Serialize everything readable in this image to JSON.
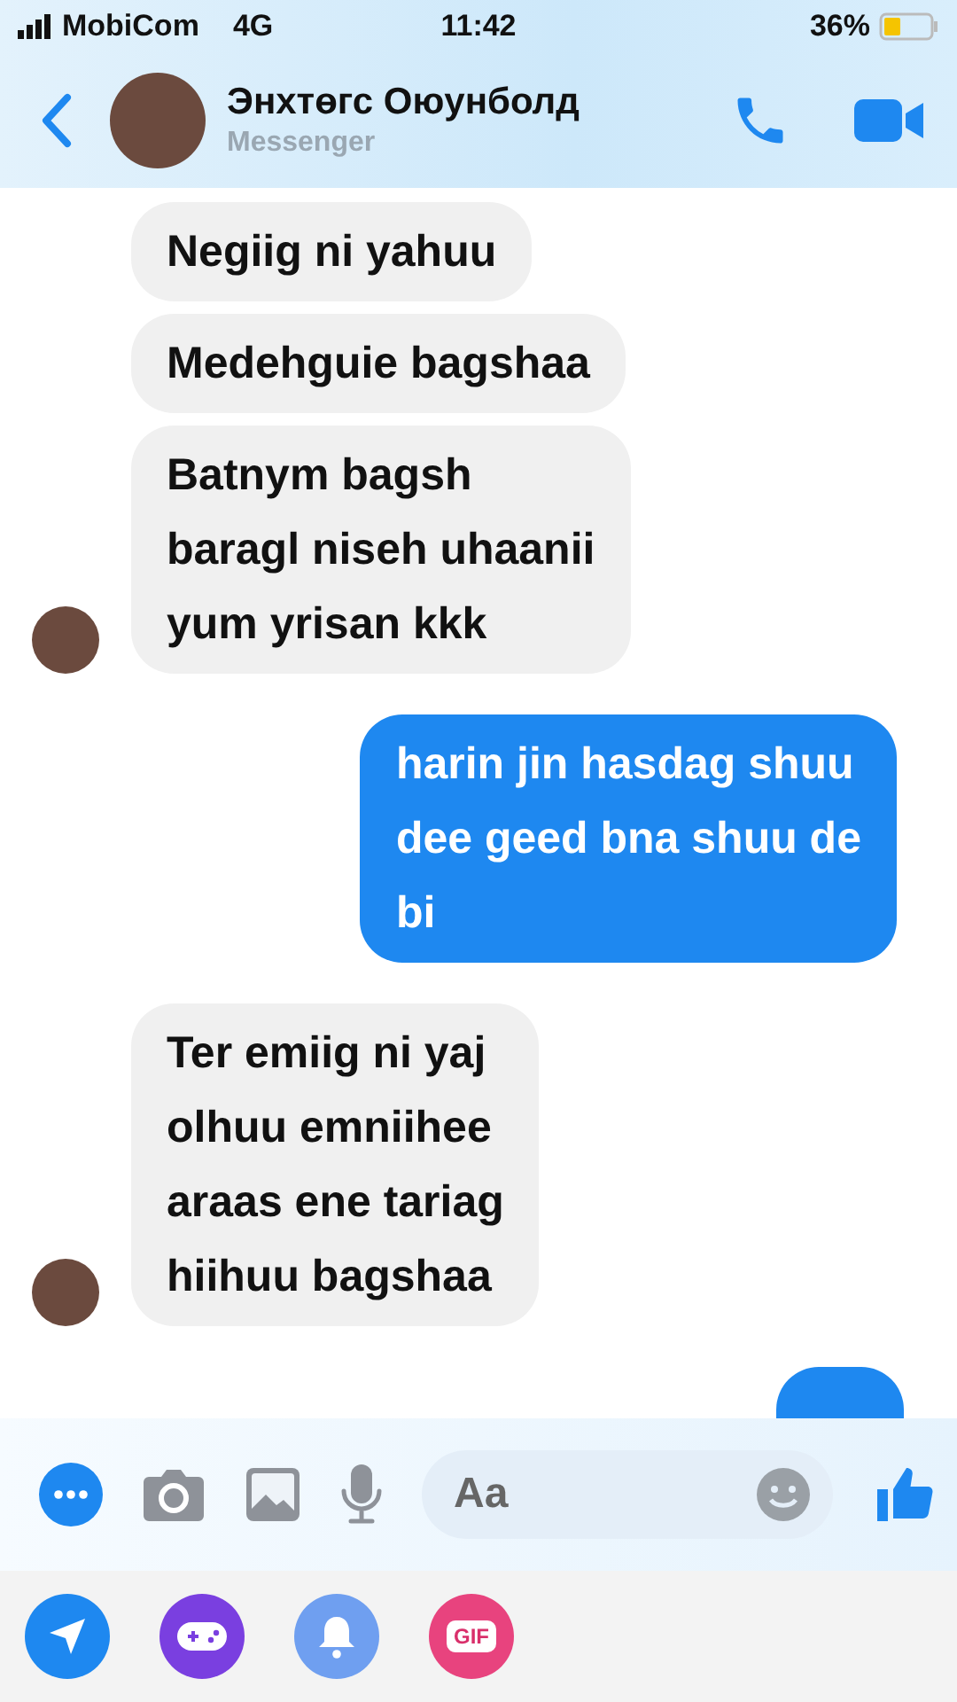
{
  "status_bar": {
    "carrier": "MobiCom",
    "network": "4G",
    "time": "11:42",
    "battery": "36%"
  },
  "header": {
    "name": "Энхтөгс Оюунболд",
    "subtitle": "Messenger"
  },
  "messages": [
    {
      "kind": "incoming",
      "text": "Negiig ni yahuu",
      "show_avatar": false
    },
    {
      "kind": "incoming",
      "text": "Medehguie bagshaa",
      "show_avatar": false
    },
    {
      "kind": "incoming",
      "text": "Batnym bagsh\nbaragl niseh uhaanii\nyum yrisan kkk",
      "show_avatar": true
    },
    {
      "kind": "outgoing",
      "text": "harin jin hasdag shuu\ndee geed bna shuu de\nbi"
    },
    {
      "kind": "incoming",
      "text": "Ter emiig ni yaj\nolhuu emniihee\naraas ene tariag\nhiihuu bagshaa",
      "show_avatar": true
    },
    {
      "kind": "outgoing_partial"
    }
  ],
  "composer": {
    "placeholder": "Aa"
  },
  "apps": [
    {
      "kind": "send"
    },
    {
      "kind": "game"
    },
    {
      "kind": "bell"
    },
    {
      "kind": "gif",
      "label": "GIF"
    }
  ]
}
